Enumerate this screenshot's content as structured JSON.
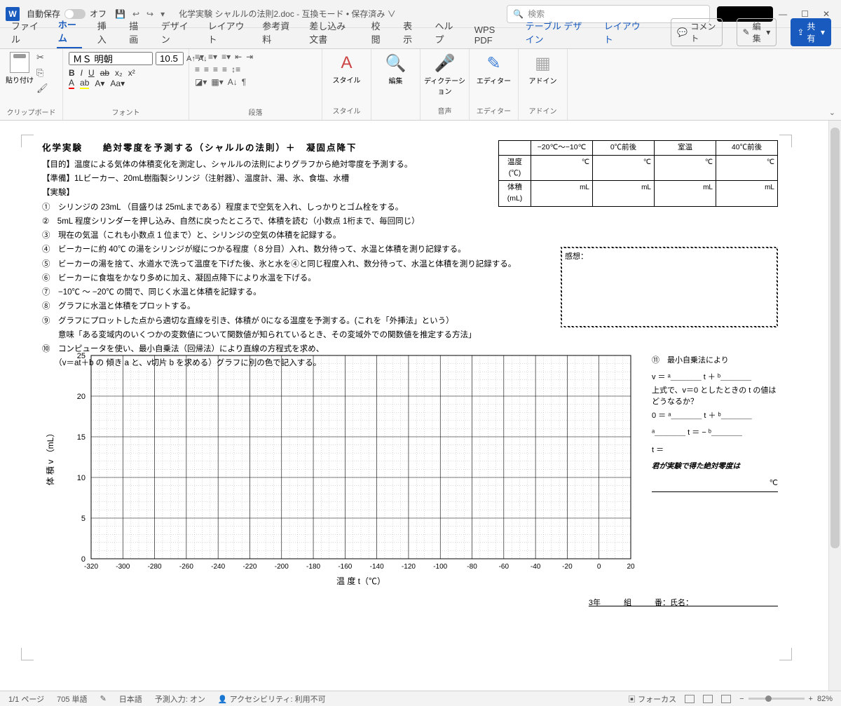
{
  "titlebar": {
    "autosave_label": "自動保存",
    "autosave_state": "オフ",
    "doc_title": "化学実験 シャルルの法則2.doc  -  互換モード • 保存済み ∨",
    "search_placeholder": "検索"
  },
  "window_controls": {
    "min": "—",
    "max": "☐",
    "close": "✕"
  },
  "tabs": {
    "file": "ファイル",
    "home": "ホーム",
    "insert": "挿入",
    "draw": "描画",
    "design": "デザイン",
    "layout": "レイアウト",
    "references": "参考資料",
    "mailings": "差し込み文書",
    "review": "校閲",
    "view": "表示",
    "help": "ヘルプ",
    "wps": "WPS PDF",
    "table_design": "テーブル デザイン",
    "table_layout": "レイアウト",
    "comment": "コメント",
    "edit": "編集",
    "share": "共有"
  },
  "ribbon": {
    "clipboard": {
      "paste": "貼り付け",
      "group": "クリップボード"
    },
    "font": {
      "name": "ＭＳ 明朝",
      "size": "10.5",
      "group": "フォント"
    },
    "paragraph": {
      "group": "段落"
    },
    "style": {
      "label": "スタイル",
      "group": "スタイル"
    },
    "edit": {
      "label": "編集"
    },
    "dictation": {
      "label": "ディクテーション",
      "group": "音声"
    },
    "editor": {
      "label": "エディター",
      "group": "エディター"
    },
    "addin": {
      "label": "アドイン",
      "group": "アドイン"
    }
  },
  "doc": {
    "title": "化学実験　　絶対零度を予測する（シャルルの法則）＋　凝固点降下",
    "purpose": "【目的】温度による気体の体積変化を測定し、シャルルの法則によりグラフから絶対零度を予測する。",
    "prep": "【準備】1Lビーカー、20mL樹脂製シリンジ（注射器）、温度計、湯、氷、食塩、水槽",
    "exp_h": "【実験】",
    "steps": [
      "①　シリンジの 23mL （目盛りは 25mLまである）程度まで空気を入れ、しっかりとゴム栓をする。",
      "②　5mL 程度シリンダーを押し込み、自然に戻ったところで、体積を読む（小数点 1桁まで、毎回同じ）",
      "③　現在の気温（これも小数点 1 位まで）と、シリンジの空気の体積を記録する。",
      "④　ビーカーに約 40℃ の湯をシリンジが縦につかる程度（８分目）入れ、数分待って、水温と体積を測り記録する。",
      "⑤　ビーカーの湯を捨て、水道水で洗って温度を下げた後、氷と水を④と同じ程度入れ、数分待って、水温と体積を測り記録する。",
      "⑥　ビーカーに食塩をかなり多めに加え、凝固点降下により水温を下げる。",
      "⑦　−10℃ ～  −20℃ の間で、同じく水温と体積を記録する。",
      "⑧　グラフに水温と体積をプロットする。",
      "⑨　グラフにプロットした点から適切な直線を引き、体積が 0になる温度を予測する。(これを「外挿法」という）",
      "　　意味「ある変域内のいくつかの変数値について関数値が知られているとき、その変域外での関数値を推定する方法」",
      "⑩　コンピュータを使い、最小自乗法（回帰法）により直線の方程式を求め、",
      "　　（v＝at＋b の 傾き a と、v切片 b を求める）グラフに別の色で記入する。"
    ],
    "table": {
      "rowh": [
        "温度(℃)",
        "体積(mL)"
      ],
      "cols": [
        "−20℃～−10℃",
        "0℃前後",
        "室温",
        "40℃前後"
      ],
      "unit_c": "℃",
      "unit_ml": "mL"
    },
    "thoughts": "感想：",
    "side": {
      "h": "⑪　最小自乗法により",
      "l1": "v ＝ ᵃ＿＿＿＿ t ＋ ᵇ＿＿＿＿",
      "l2": "上式で、v＝0 としたときの t の値はどうなるか？",
      "l3": "0 ＝ ᵃ＿＿＿＿ t ＋ ᵇ＿＿＿＿",
      "l4": "ᵃ＿＿＿＿ t ＝ − ᵇ＿＿＿＿",
      "l5": "t ＝",
      "em": "君が実験で得た絶対零度は",
      "deg": "℃"
    },
    "sign": "3年　　　組　　　番：氏名：＿＿＿＿＿＿＿＿＿＿＿"
  },
  "chart_data": {
    "type": "scatter",
    "title": "",
    "xlabel": "温 度  t（℃）",
    "ylabel": "体 積 v （mL）",
    "xlim": [
      -320,
      20
    ],
    "ylim": [
      0,
      25
    ],
    "xticks": [
      -320,
      -300,
      -280,
      -260,
      -240,
      -220,
      -200,
      -180,
      -160,
      -140,
      -120,
      -100,
      -80,
      -60,
      -40,
      -20,
      0,
      20
    ],
    "yticks": [
      0,
      5,
      10,
      15,
      20,
      25
    ],
    "series": []
  },
  "status": {
    "page": "1/1 ページ",
    "words": "705 単語",
    "lang": "日本語",
    "ime": "予測入力: オン",
    "a11y": "アクセシビリティ: 利用不可",
    "focus": "フォーカス",
    "zoom": "82%"
  }
}
